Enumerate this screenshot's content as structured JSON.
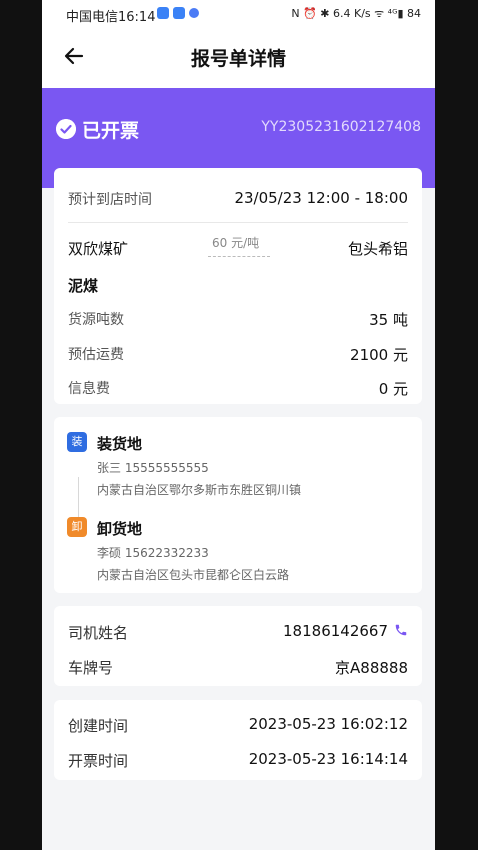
{
  "status_bar": {
    "carrier_time": "中国电信16:14",
    "right_icons": "N ⏰ ✱ 6.4 K/s ᯤ ⁴ᴳ▮ 84"
  },
  "nav": {
    "title": "报号单详情"
  },
  "banner": {
    "status": "已开票",
    "order_no": "YY2305231602127408",
    "color": "#7a57f2"
  },
  "info": {
    "eta_label": "预计到店时间",
    "eta_value": "23/05/23 12:00 - 18:00",
    "origin": "双欣煤矿",
    "price": "60 元/吨",
    "destination": "包头希铝",
    "cargo": "泥煤",
    "tonnage_label": "货源吨数",
    "tonnage_value": "35 吨",
    "freight_label": "预估运费",
    "freight_value": "2100 元",
    "fee_label": "信息费",
    "fee_value": "0 元"
  },
  "address": {
    "load": {
      "badge": "装",
      "title": "装货地",
      "contact": "张三 15555555555",
      "addr": "内蒙古自治区鄂尔多斯市东胜区铜川镇",
      "color": "#2f6de1"
    },
    "unload": {
      "badge": "卸",
      "title": "卸货地",
      "contact": "李硕 15622332233",
      "addr": "内蒙古自治区包头市昆都仑区白云路",
      "color": "#f08a2a"
    }
  },
  "driver": {
    "name_label": "司机姓名",
    "name_value": "18186142667",
    "plate_label": "车牌号",
    "plate_value": "京A88888"
  },
  "times": {
    "created_label": "创建时间",
    "created_value": "2023-05-23 16:02:12",
    "invoiced_label": "开票时间",
    "invoiced_value": "2023-05-23 16:14:14"
  }
}
